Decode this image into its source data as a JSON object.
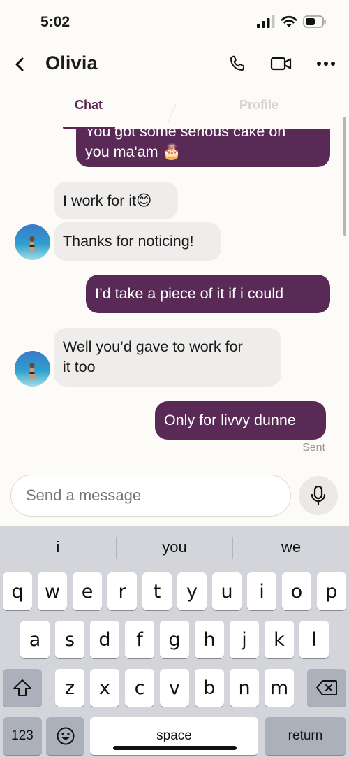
{
  "status_bar": {
    "time": "5:02"
  },
  "header": {
    "contact_name": "Olivia"
  },
  "tabs": [
    {
      "label": "Chat"
    },
    {
      "label": "Profile"
    }
  ],
  "messages": [
    {
      "direction": "out",
      "text_line1": "You got some serious cake on",
      "text_line2": "you ma'am 🎂"
    },
    {
      "direction": "in",
      "text": "I work for it😊"
    },
    {
      "direction": "in",
      "text": "Thanks for noticing!"
    },
    {
      "direction": "out",
      "text": "I’d take a piece of it if i could"
    },
    {
      "direction": "in",
      "text_line1": "Well you’d gave to work for",
      "text_line2": "it too"
    },
    {
      "direction": "out",
      "text": "Only for livvy dunne"
    }
  ],
  "sent_status": "Sent",
  "composer": {
    "placeholder": "Send a message"
  },
  "keyboard": {
    "suggestions": [
      "i",
      "you",
      "we"
    ],
    "row1": [
      "q",
      "w",
      "e",
      "r",
      "t",
      "y",
      "u",
      "i",
      "o",
      "p"
    ],
    "row2": [
      "a",
      "s",
      "d",
      "f",
      "g",
      "h",
      "j",
      "k",
      "l"
    ],
    "row3": [
      "z",
      "x",
      "c",
      "v",
      "b",
      "n",
      "m"
    ],
    "numbers_label": "123",
    "space_label": "space",
    "return_label": "return"
  },
  "colors": {
    "accent": "#5a2a57",
    "incoming_bubble": "#efedeb",
    "keyboard_bg": "#d3d5db"
  }
}
